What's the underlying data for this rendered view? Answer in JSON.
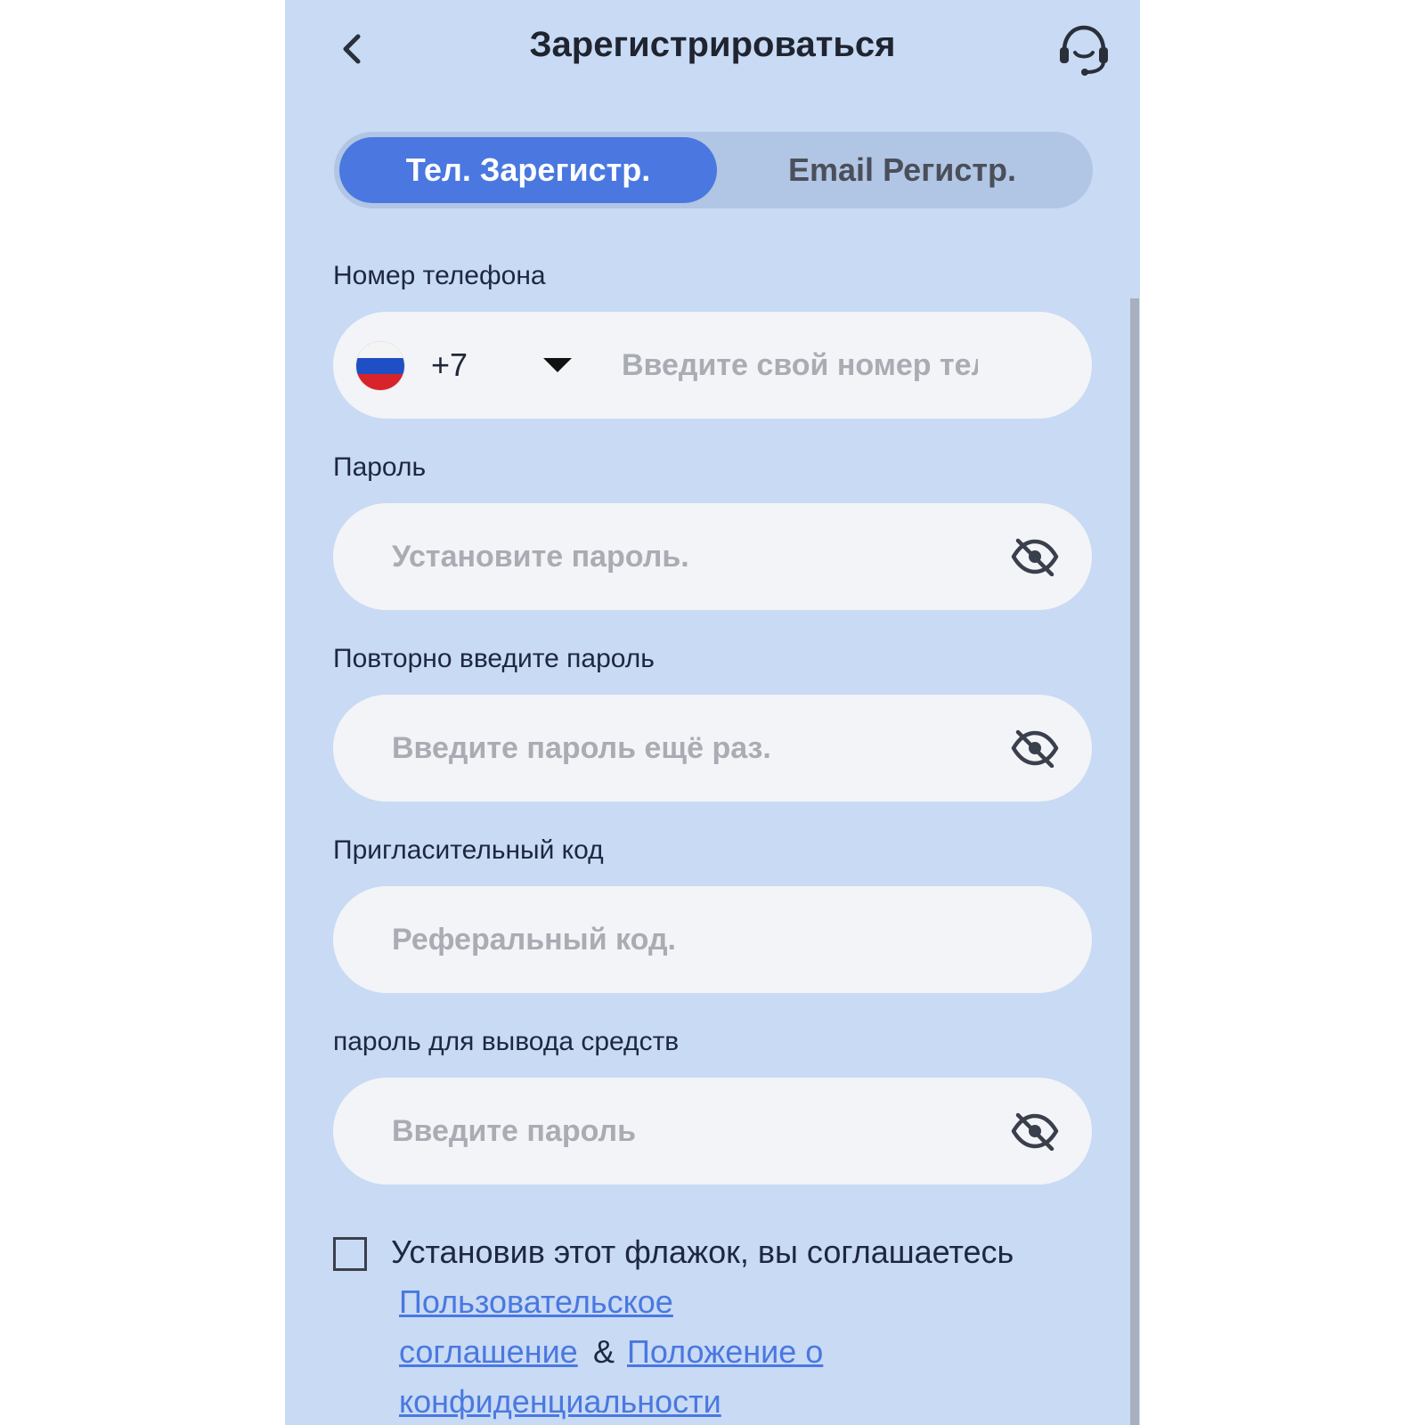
{
  "header": {
    "title": "Зарегистрироваться"
  },
  "tabs": [
    {
      "label": "Тел. Зарегистр.",
      "active": true
    },
    {
      "label": "Email Регистр.",
      "active": false
    }
  ],
  "phone": {
    "label": "Номер телефона",
    "country_code": "+7",
    "placeholder": "Введите свой номер тел"
  },
  "password": {
    "label": "Пароль",
    "placeholder": "Установите пароль."
  },
  "confirm_password": {
    "label": "Повторно введите пароль",
    "placeholder": "Введите пароль ещё раз."
  },
  "invite_code": {
    "label": "Пригласительный код",
    "placeholder": "Реферальный код."
  },
  "withdraw_password": {
    "label": "пароль для вывода средств",
    "placeholder": "Введите пароль"
  },
  "agreement": {
    "text": "Установив этот флажок, вы соглашаетесь",
    "link1_line1": "Пользовательское",
    "link1_line2": "соглашение",
    "amp": "&",
    "link2_line1": "Положение о",
    "link2_line2": "конфиденциальности",
    "checked": false
  },
  "colors": {
    "background": "#c8daf4",
    "accent": "#4a78e0",
    "field": "#f3f4f7"
  },
  "icons": {
    "back": "chevron-left-icon",
    "support": "headset-icon",
    "flag": "russia-flag-icon",
    "caret": "caret-down-icon",
    "eye": "eye-off-icon"
  }
}
